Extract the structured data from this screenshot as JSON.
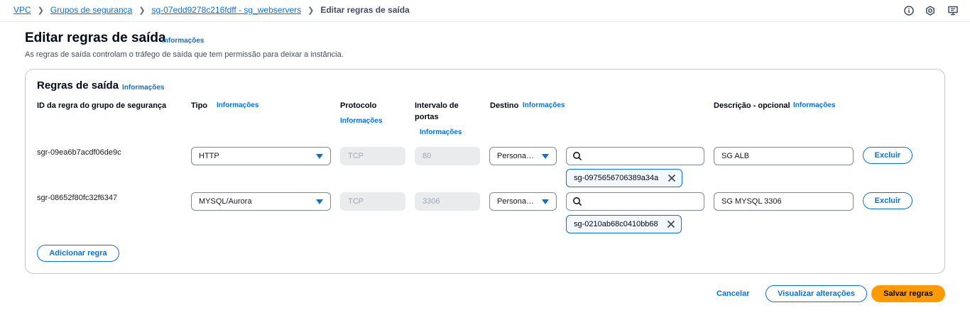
{
  "breadcrumb": {
    "items": [
      "VPC",
      "Grupos de segurança",
      "sg-07edd9278c216fdff - sg_webservers"
    ],
    "current": "Editar regras de saída"
  },
  "top_icons": [
    "info-circle-icon",
    "settings-hexagon-icon",
    "feedback-screen-icon"
  ],
  "header": {
    "title": "Editar regras de saída",
    "info_label": "Informações",
    "description": "As regras de saída controlam o tráfego de saída que tem permissão para deixar a instância."
  },
  "panel": {
    "title": "Regras de saída",
    "info_label": "Informações",
    "columns": {
      "rule_id": "ID da regra do grupo de segurança",
      "type": "Tipo",
      "type_info": "Informações",
      "protocol": "Protocolo",
      "protocol_info": "Informações",
      "port_range_line1": "Intervalo de",
      "port_range_line2": "portas",
      "port_range_info": "Informações",
      "destination": "Destino",
      "destination_info": "Informações",
      "description": "Descrição - opcional",
      "description_info": "Informações"
    },
    "rules": [
      {
        "id": "sgr-09ea6b7acdf06de9c",
        "type": "HTTP",
        "protocol": "TCP",
        "port_range": "80",
        "destination_type": "Persona…",
        "search_value": "",
        "token": "sg-0975656706389a34a",
        "description": "SG ALB",
        "delete_label": "Excluir"
      },
      {
        "id": "sgr-08652f80fc32f6347",
        "type": "MYSQL/Aurora",
        "protocol": "TCP",
        "port_range": "3306",
        "destination_type": "Persona…",
        "search_value": "",
        "token": "sg-0210ab68c0410bb68",
        "description": "SG MYSQL 3306",
        "delete_label": "Excluir"
      }
    ],
    "add_rule_label": "Adicionar regra"
  },
  "footer": {
    "cancel_label": "Cancelar",
    "preview_label": "Visualizar alterações",
    "save_label": "Salvar regras"
  },
  "colors": {
    "link": "#0972d3",
    "primary_button": "#ff9900",
    "border": "#c6c6cd",
    "disabled_bg": "#e9ebed"
  }
}
